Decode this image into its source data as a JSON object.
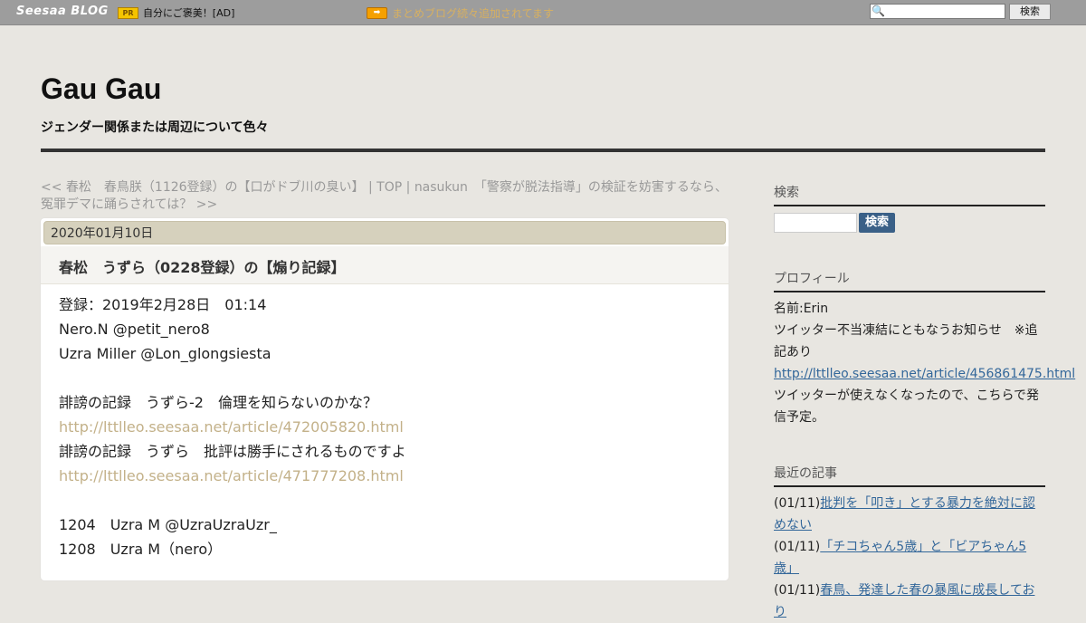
{
  "topbar": {
    "logo": "Seesaa BLOG",
    "pr_badge": "PR",
    "pr_text": "自分にご褒美！[AD]",
    "arrow_badge": "➡",
    "promo_link": "まとめブログ続々追加されてます",
    "search_button": "検索"
  },
  "header": {
    "title": "Gau Gau",
    "description": "ジェンダー関係または周辺について色々"
  },
  "nav": {
    "prev": "<< 春松　春鳥朕（1126登録）の【口がドブ川の臭い】",
    "separator1": " | ",
    "top": "TOP",
    "separator2": " | ",
    "next": "nasukun　「警察が脱法指導」の検証を妨害するなら、冤罪デマに踊らされては？ >>"
  },
  "article": {
    "date": "2020年01月10日",
    "title": "春松　うずら（0228登録）の【煽り記録】",
    "lines": [
      {
        "text": "登録：2019年2月28日　01:14",
        "link": false
      },
      {
        "text": "Nero.N @petit_nero8",
        "link": false
      },
      {
        "text": "Uzra Miller @Lon_glongsiesta",
        "link": false
      },
      {
        "text": "",
        "link": false
      },
      {
        "text": "誹謗の記録　うずら-2　倫理を知らないのかな？",
        "link": false
      },
      {
        "text": "http://lttlleo.seesaa.net/article/472005820.html",
        "link": true
      },
      {
        "text": "誹謗の記録　うずら　批評は勝手にされるものですよ",
        "link": false
      },
      {
        "text": "http://lttlleo.seesaa.net/article/471777208.html",
        "link": true
      },
      {
        "text": "",
        "link": false
      },
      {
        "text": "1204　Uzra M @UzraUzraUzr_",
        "link": false
      },
      {
        "text": "1208　Uzra M（nero）",
        "link": false
      }
    ]
  },
  "sidebar": {
    "search_heading": "検索",
    "search_button": "検索",
    "profile_heading": "プロフィール",
    "profile_name": "名前:Erin",
    "profile_notice": "ツイッター不当凍結にともなうお知らせ　※追記あり",
    "profile_link": "http://lttlleo.seesaa.net/article/456861475.html",
    "profile_note": "ツイッターが使えなくなったので、こちらで発信予定。",
    "recent_heading": "最近の記事",
    "recent": [
      {
        "date": "(01/11)",
        "title": "批判を「叩き」とする暴力を絶対に認めない"
      },
      {
        "date": "(01/11)",
        "title": "「チコちゃん5歳」と「ビアちゃん5歳」"
      },
      {
        "date": "(01/11)",
        "title": "春鳥、発達した春の暴風に成長しており"
      }
    ]
  }
}
